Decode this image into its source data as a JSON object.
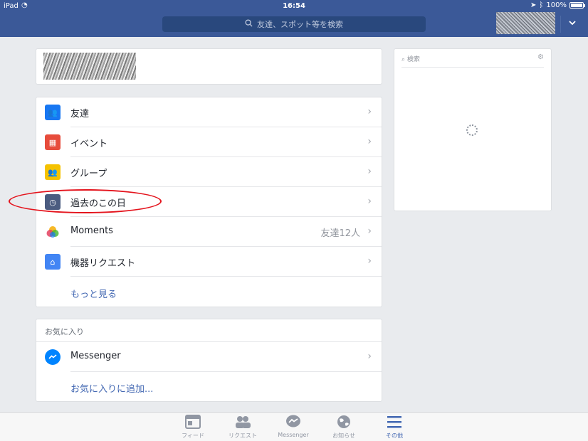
{
  "status": {
    "carrier": "iPad",
    "time": "16:54",
    "battery": "100%"
  },
  "header": {
    "search_placeholder": "友達、スポット等を検索"
  },
  "menu": {
    "items": [
      {
        "label": "友達",
        "color": "#1877f2"
      },
      {
        "label": "イベント",
        "color": "#e74c3c"
      },
      {
        "label": "グループ",
        "color": "#f5c200"
      },
      {
        "label": "過去のこの日",
        "color": "#4b5c80"
      },
      {
        "label": "Moments",
        "meta": "友達12人"
      },
      {
        "label": "機器リクエスト",
        "color": "#4285f4"
      }
    ],
    "more": "もっと見る"
  },
  "favorites": {
    "header": "お気に入り",
    "items": [
      {
        "label": "Messenger",
        "color": "#0084ff"
      }
    ],
    "add": "お気に入りに追加..."
  },
  "sidebar": {
    "search_label": "検索"
  },
  "tabs": [
    {
      "label": "フィード",
      "icon": "feed-icon"
    },
    {
      "label": "リクエスト",
      "icon": "friend-requests-icon"
    },
    {
      "label": "Messenger",
      "icon": "messenger-icon"
    },
    {
      "label": "お知らせ",
      "icon": "globe-icon"
    },
    {
      "label": "その他",
      "icon": "menu-icon",
      "active": true
    }
  ]
}
